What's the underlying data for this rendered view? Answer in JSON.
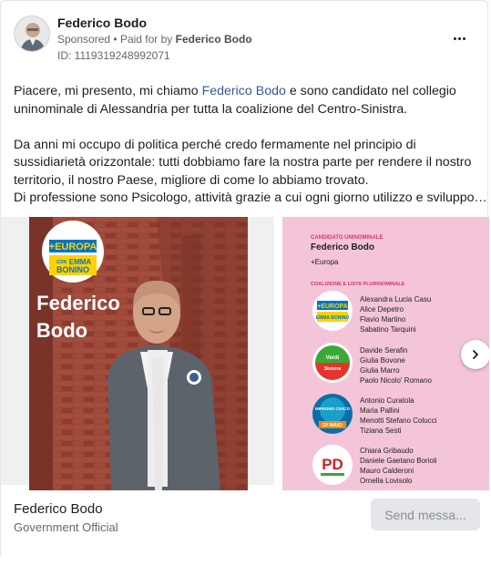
{
  "post": {
    "page_name": "Federico Bodo",
    "sponsored_label": "Sponsored",
    "paid_for_prefix": "Paid for by",
    "paid_for_name": "Federico Bodo",
    "library_id": "ID: 1119319248992071",
    "more_icon": "more-horizontal-icon",
    "text": {
      "l1_a": "Piacere, mi presento, mi chiamo ",
      "l1_link": "Federico Bodo",
      "l1_b": " e sono candidato nel collegio",
      "l2": "uninominale di Alessandria per tutta la coalizione del Centro-Sinistra.",
      "l3": "Da anni mi occupo di politica perché credo fermamente nel principio di",
      "l4": "sussidiarietà orizzontale: tutti dobbiamo fare la nostra parte per rendere il nostro",
      "l5": "territorio, il nostro Paese, migliore di come lo abbiamo trovato.",
      "l6": "Di professione sono Psicologo, attività grazie a cui ogni giorno utilizzo e sviluppo…"
    }
  },
  "slide1": {
    "logo_line1": "+EUROPA",
    "logo_line2": "CON",
    "logo_line3": "EMMA",
    "logo_line4": "BONINO",
    "name_first": "Federico",
    "name_last": "Bodo"
  },
  "slide2": {
    "header_small": "CANDIDATO UNINOMINALE",
    "candidate": "Federico Bodo",
    "party": "+Europa",
    "section_title": "COALIZIONE E LISTA PLURINOMINALE",
    "groups": [
      {
        "logo": "+EUROPA / EMMA BONINO",
        "names": [
          "Alexandra Lucia Casu",
          "Alice Depetro",
          "Flavio Martino",
          "Sabatino Tarquini"
        ]
      },
      {
        "logo": "Europa Verde / Sinistra Italiana",
        "names": [
          "Davide Serafin",
          "Giulia Bovone",
          "Giulia Marro",
          "Paolo Nicolo' Romano"
        ]
      },
      {
        "logo": "Impegno Civico Di Maio",
        "names": [
          "Antonio Curatola",
          "Maria Pallini",
          "Menotti Stefano Colucci",
          "Tiziana Sesti"
        ]
      },
      {
        "logo": "PD",
        "names": [
          "Chiara Gribaudo",
          "Daniele Gaetano Borioli",
          "Mauro Calderoni",
          "Ornella Lovisolo"
        ]
      }
    ],
    "logo_texts": {
      "europa": "+EUROPA",
      "bonino": "EMMA BONINO",
      "verdi": "Verdi",
      "sinistra": "Sinistra",
      "impegno": "IMPEGNO CIVICO",
      "dimaio": "DI MAIO",
      "pd": "PD"
    }
  },
  "footer": {
    "name": "Federico Bodo",
    "category": "Government Official",
    "cta": "Send messa..."
  },
  "colors": {
    "link": "#385898",
    "pink_bg": "#f4c5d8",
    "brick": "#8b3b2f"
  }
}
